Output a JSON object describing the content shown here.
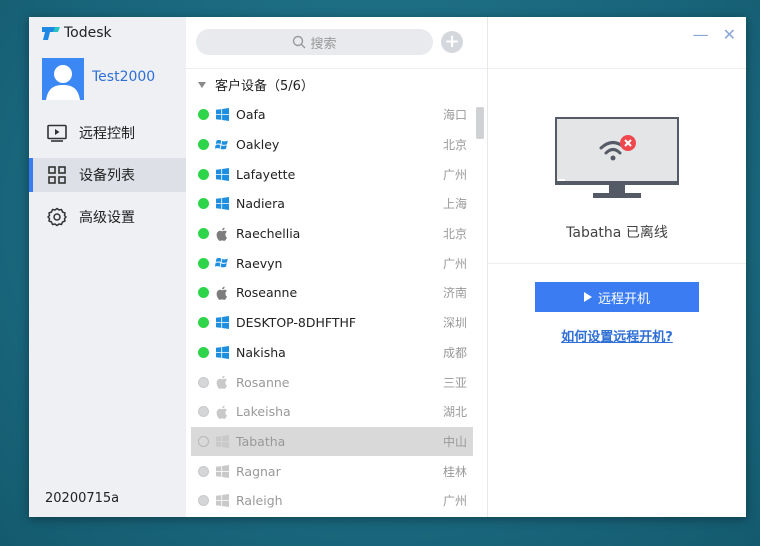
{
  "app": {
    "name": "Todesk"
  },
  "user": {
    "name": "Test2000"
  },
  "nav": {
    "items": [
      {
        "label": "远程控制",
        "icon": "remote-control-icon"
      },
      {
        "label": "设备列表",
        "icon": "device-list-icon"
      },
      {
        "label": "高级设置",
        "icon": "gear-icon"
      }
    ],
    "active_index": 1
  },
  "version": "20200715a",
  "search": {
    "placeholder": "搜索"
  },
  "group": {
    "title": "客户设备（5/6）"
  },
  "devices": [
    {
      "name": "Oafa",
      "os": "windows",
      "city": "海口",
      "online": true
    },
    {
      "name": "Oakley",
      "os": "windows-old",
      "city": "北京",
      "online": true
    },
    {
      "name": "Lafayette",
      "os": "windows",
      "city": "广州",
      "online": true
    },
    {
      "name": "Nadiera",
      "os": "windows",
      "city": "上海",
      "online": true
    },
    {
      "name": "Raechellia",
      "os": "apple",
      "city": "北京",
      "online": true
    },
    {
      "name": "Raevyn",
      "os": "windows-old",
      "city": "广州",
      "online": true
    },
    {
      "name": "Roseanne",
      "os": "apple",
      "city": "济南",
      "online": true
    },
    {
      "name": "DESKTOP-8DHFTHF",
      "os": "windows",
      "city": "深圳",
      "online": true
    },
    {
      "name": "Nakisha",
      "os": "windows",
      "city": "成都",
      "online": true
    },
    {
      "name": "Rosanne",
      "os": "apple",
      "city": "三亚",
      "online": false
    },
    {
      "name": "Lakeisha",
      "os": "apple",
      "city": "湖北",
      "online": false
    },
    {
      "name": "Tabatha",
      "os": "windows",
      "city": "中山",
      "online": false,
      "selected": true
    },
    {
      "name": "Ragnar",
      "os": "windows",
      "city": "桂林",
      "online": false
    },
    {
      "name": "Raleigh",
      "os": "windows",
      "city": "广州",
      "online": false
    }
  ],
  "detail": {
    "status_text": "Tabatha 已离线",
    "wake_button": "远程开机",
    "help_link": "如何设置远程开机?"
  },
  "colors": {
    "accent": "#3b7cf3",
    "online": "#2ed44a",
    "offline": "#d5d6d8",
    "error": "#f0474c"
  }
}
